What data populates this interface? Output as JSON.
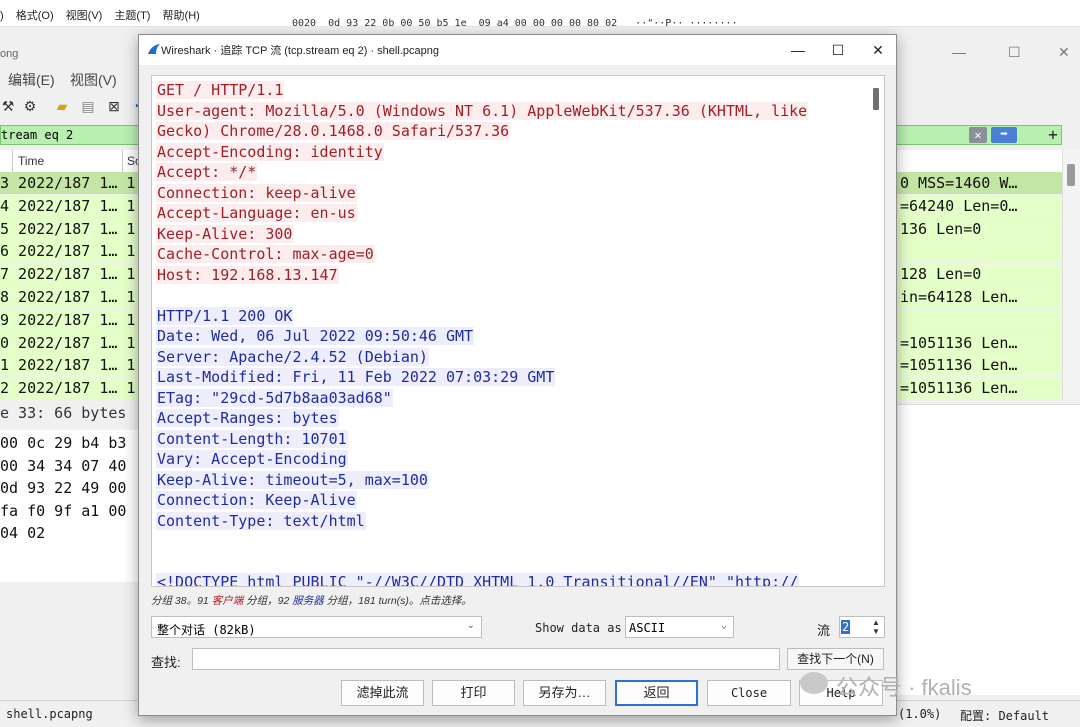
{
  "background": {
    "menu": [
      "格式(O)",
      "视图(V)",
      "主题(T)",
      "帮助(H)"
    ],
    "menu_prefix": ")",
    "hex_line": "0020  0d 93 22 0b 00 50 b5 1e  09 a4 00 00 00 00 80 02   ··\"··P·· ········",
    "window_title_fragment": "ong",
    "window_controls": [
      "—",
      "☐",
      "✕"
    ],
    "app_menu": [
      "编辑(E)",
      "视图(V)"
    ],
    "filter_text": "tream eq 2",
    "packet_columns": [
      "Time",
      "So"
    ],
    "packet_rows": [
      {
        "left": "3 2022/187 1… 1",
        "right": "0 MSS=1460 W…",
        "selected": true
      },
      {
        "left": "4 2022/187 1… 1",
        "right": "=64240 Len=0…",
        "selected": false
      },
      {
        "left": "5 2022/187 1… 1",
        "right": "136 Len=0",
        "selected": false
      },
      {
        "left": "6 2022/187 1… 1",
        "right": "",
        "selected": false
      },
      {
        "left": "7 2022/187 1… 1",
        "right": "128 Len=0",
        "selected": false
      },
      {
        "left": "8 2022/187 1… 1",
        "right": "in=64128 Len…",
        "selected": false
      },
      {
        "left": "9 2022/187 1… 1",
        "right": "",
        "selected": false
      },
      {
        "left": "0 2022/187 1… 1",
        "right": "=1051136 Len…",
        "selected": false
      },
      {
        "left": "1 2022/187 1… 1",
        "right": "=1051136 Len…",
        "selected": false
      },
      {
        "left": "2 2022/187 1… 1",
        "right": "=1051136 Len…",
        "selected": false
      }
    ],
    "bytes_separator": "e 33: 66 bytes",
    "bytes_lines": [
      "00 0c 29 b4 b3",
      "00 34 34 07 40",
      "0d 93 22 49 00",
      "fa f0 9f a1 00",
      "04 02"
    ],
    "status_file": "shell.pcapng",
    "status_percent": "(1.0%)",
    "status_profile": "配置: Default",
    "watermark": "公众号 · fkalis"
  },
  "dialog": {
    "title": "Wireshark · 追踪 TCP 流 (tcp.stream eq 2) · shell.pcapng",
    "controls": {
      "minimize": "—",
      "maximize": "☐",
      "close": "✕"
    },
    "client_lines": [
      "GET / HTTP/1.1",
      "User-agent: Mozilla/5.0 (Windows NT 6.1) AppleWebKit/537.36 (KHTML, like",
      "Gecko) Chrome/28.0.1468.0 Safari/537.36",
      "Accept-Encoding: identity",
      "Accept: */*",
      "Connection: keep-alive",
      "Accept-Language: en-us",
      "Keep-Alive: 300",
      "Cache-Control: max-age=0",
      "Host: 192.168.13.147"
    ],
    "server_lines": [
      "HTTP/1.1 200 OK",
      "Date: Wed, 06 Jul 2022 09:50:46 GMT",
      "Server: Apache/2.4.52 (Debian)",
      "Last-Modified: Fri, 11 Feb 2022 07:03:29 GMT",
      "ETag: \"29cd-5d7b8aa03ad68\"",
      "Accept-Ranges: bytes",
      "Content-Length: 10701",
      "Vary: Accept-Encoding",
      "Keep-Alive: timeout=5, max=100",
      "Connection: Keep-Alive",
      "Content-Type: text/html"
    ],
    "server_doctype_line": "<!DOCTYPE html PUBLIC \"-//W3C//DTD XHTML 1.0 Transitional//EN\" \"http://",
    "summary": {
      "p1": "分组 38。91 ",
      "client": "客户端",
      "p2": " 分组，92 ",
      "server": "服务器",
      "p3": " 分组，181 turn(s)。点击选择。"
    },
    "conversation_select": "整个对话 (82kB)",
    "show_data_as_label": "Show data as",
    "encoding": "ASCII",
    "stream_label": "流",
    "stream_value": "2",
    "find_label": "查找:",
    "find_value": "",
    "find_next": "查找下一个(N)",
    "buttons": {
      "filter_out": "滤掉此流",
      "print": "打印",
      "save_as": "另存为…",
      "back": "返回",
      "close": "Close",
      "help": "Help"
    }
  }
}
